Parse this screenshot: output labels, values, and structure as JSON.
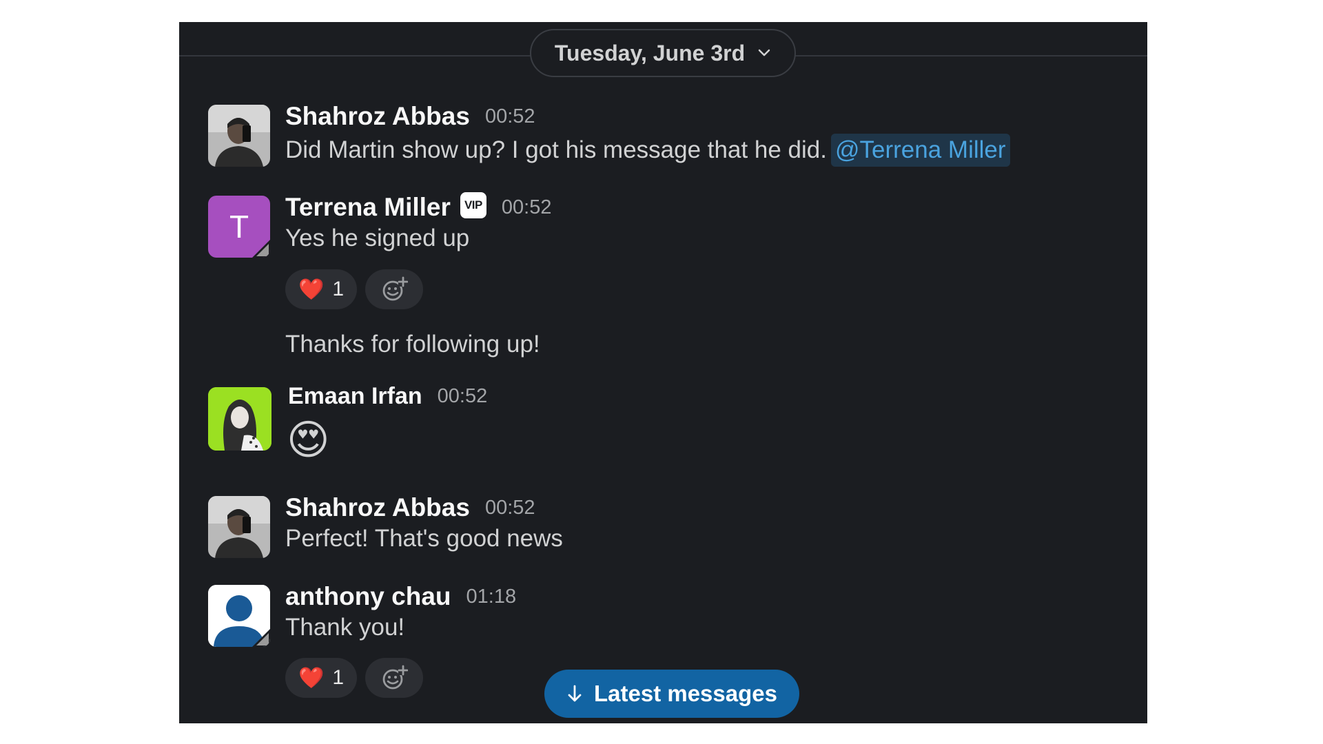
{
  "date_divider": {
    "label": "Tuesday, June 3rd"
  },
  "messages": [
    {
      "sender": "Shahroz Abbas",
      "time": "00:52",
      "text": "Did Martin show up? I got his message that he did.",
      "mention": "@Terrena Miller"
    },
    {
      "sender": "Terrena Miller",
      "badge": "VIP",
      "time": "00:52",
      "avatar_initial": "T",
      "text": "Yes he signed up",
      "reaction": {
        "emoji": "❤️",
        "count": "1"
      },
      "followup": "Thanks for following up!"
    },
    {
      "sender": "Emaan Irfan",
      "time": "00:52",
      "emoji": "😍"
    },
    {
      "sender": "Shahroz Abbas",
      "time": "00:52",
      "text": "Perfect! That's good news"
    },
    {
      "sender": "anthony chau",
      "time": "01:18",
      "text": "Thank you!",
      "reaction": {
        "emoji": "❤️",
        "count": "1"
      }
    }
  ],
  "latest_button": {
    "label": "Latest messages"
  },
  "colors": {
    "background": "#1b1d21",
    "mention_text": "#4aa3df",
    "mention_bg": "#1f3548",
    "latest_button": "#1264a3",
    "terrena_avatar": "#a64fbf",
    "emaan_avatar": "#9be022"
  },
  "icons": {
    "date_chevron": "chevron-down-icon",
    "add_reaction": "add-reaction-icon",
    "latest_arrow": "arrow-down-icon"
  }
}
